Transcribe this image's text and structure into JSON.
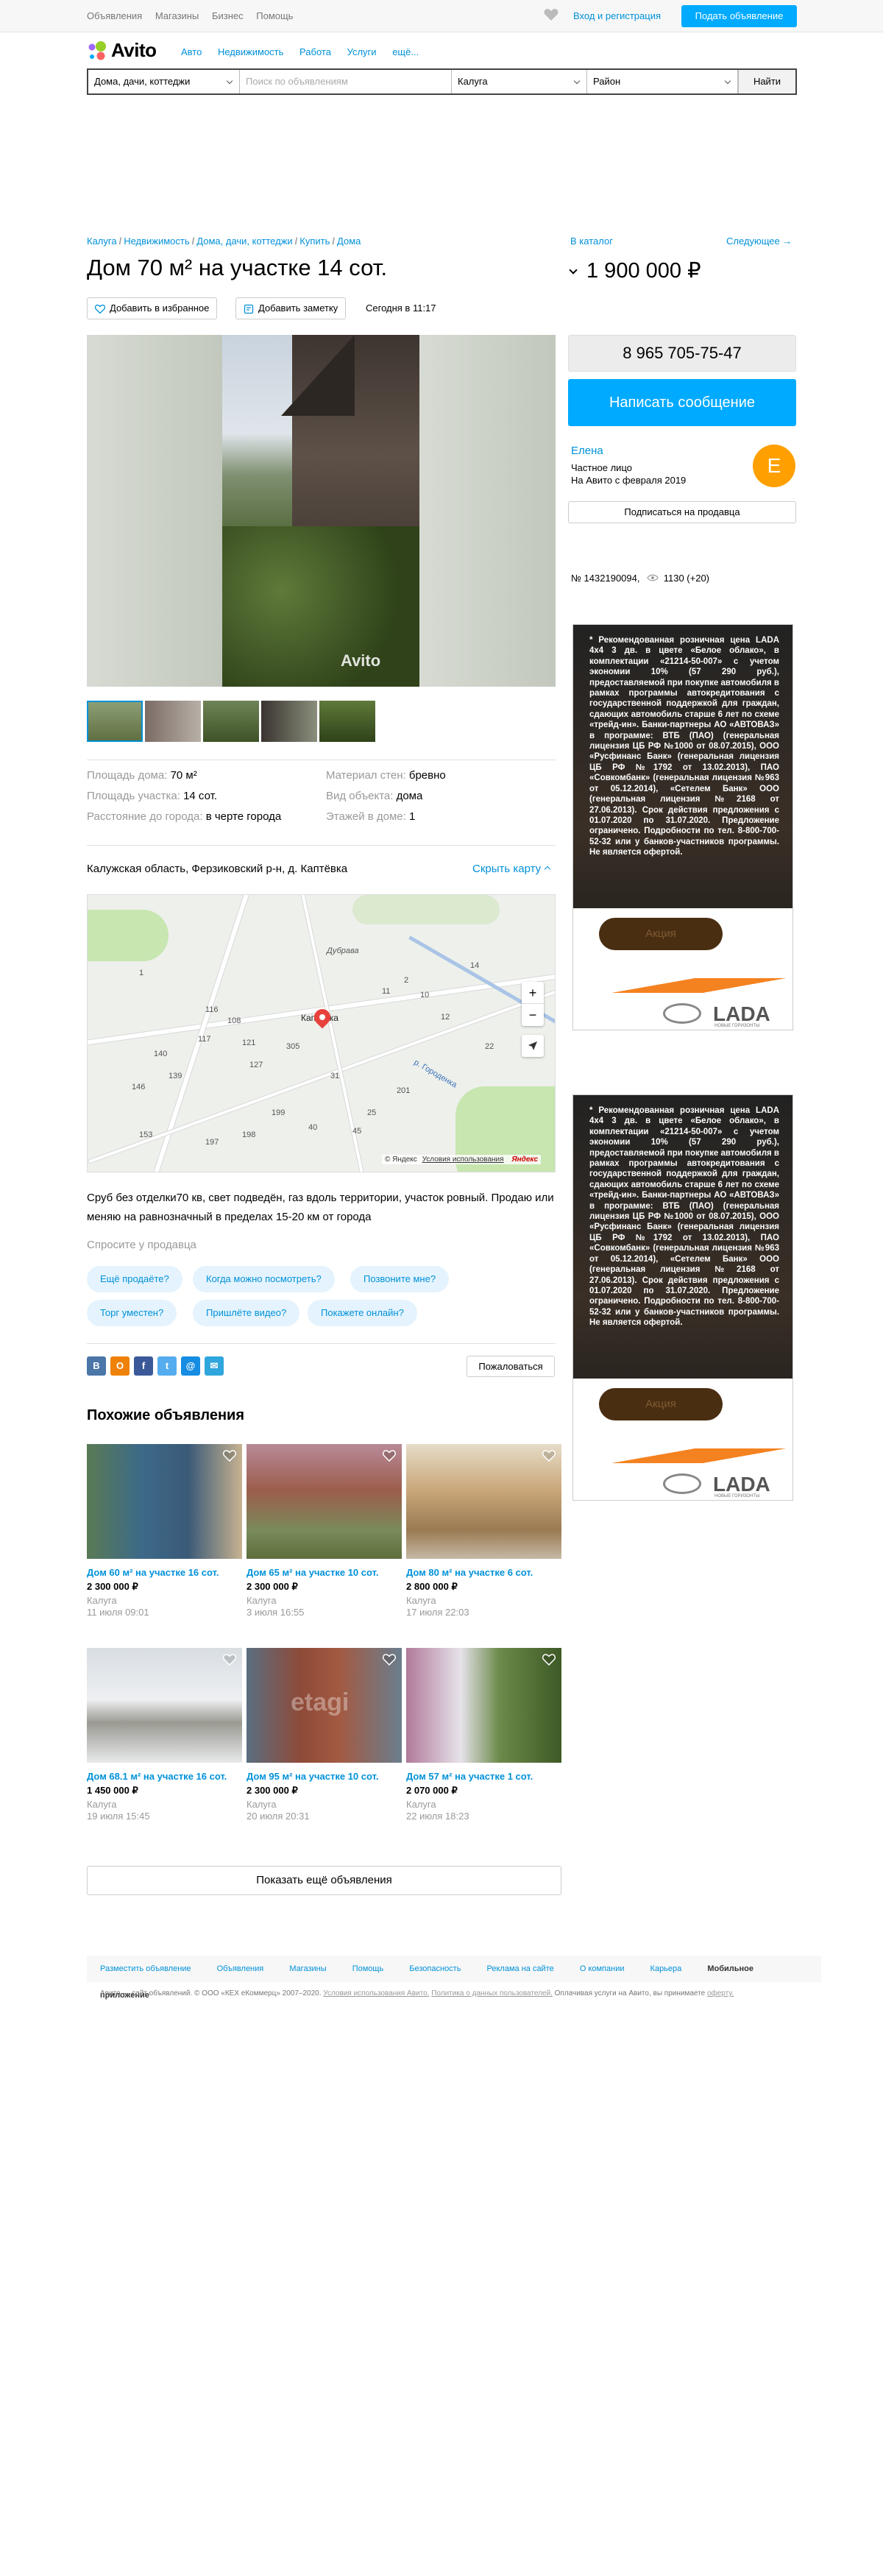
{
  "topbar": {
    "links": [
      "Объявления",
      "Магазины",
      "Бизнес",
      "Помощь"
    ],
    "login": "Вход и регистрация",
    "post_button": "Подать объявление"
  },
  "logo": {
    "text": "Avito"
  },
  "category_nav": [
    "Авто",
    "Недвижимость",
    "Работа",
    "Услуги",
    "ещё..."
  ],
  "search": {
    "category": "Дома, дачи, коттеджи",
    "placeholder": "Поиск по объявлениям",
    "city": "Калуга",
    "district": "Район",
    "button": "Найти"
  },
  "breadcrumbs": [
    "Калуга",
    "Недвижимость",
    "Дома, дачи, коттеджи",
    "Купить",
    "Дома"
  ],
  "catalog_link": "В каталог",
  "next_link": "Следующее →",
  "listing": {
    "title": "Дом 70 м² на участке 14 сот.",
    "price": "1 900 000 ₽",
    "favorite_button": "Добавить в избранное",
    "note_button": "Добавить заметку",
    "date": "Сегодня в 11:17",
    "watermark": "Avito"
  },
  "params": [
    {
      "key": "Площадь дома:",
      "value": "70 м²"
    },
    {
      "key": "Площадь участка:",
      "value": "14 сот."
    },
    {
      "key": "Расстояние до города:",
      "value": "в черте города"
    },
    {
      "key": "Материал стен:",
      "value": "бревно"
    },
    {
      "key": "Вид объекта:",
      "value": "дома"
    },
    {
      "key": "Этажей в доме:",
      "value": "1"
    }
  ],
  "address": "Калужская область, Ферзиковский р-н, д. Каптёвка",
  "hide_map": "Скрыть карту",
  "map": {
    "labels": {
      "village": "Каптёвка",
      "area": "Дубрава",
      "river": "р. Городенка",
      "houses": [
        "1",
        "2",
        "10",
        "11",
        "12",
        "14",
        "22",
        "25",
        "31",
        "40",
        "45",
        "108",
        "116",
        "117",
        "121",
        "127",
        "139",
        "140",
        "146",
        "153",
        "197",
        "198",
        "199",
        "201",
        "305"
      ]
    },
    "zoom_in": "+",
    "zoom_out": "−",
    "copyright": "© Яндекс",
    "terms": "Условия использования",
    "yandex": "Яндекс"
  },
  "description": "Сруб без отделки70 кв, свет подведён, газ вдоль территории, участок ровный. Продаю или меняю на равнозначный в пределах 15-20 км от города",
  "ask_seller": "Спросите у продавца",
  "chips": [
    "Ещё продаёте?",
    "Когда можно посмотреть?",
    "Позвоните мне?",
    "Торг уместен?",
    "Пришлёте видео?",
    "Покажете онлайн?"
  ],
  "share_icons": [
    "В",
    "О",
    "f",
    "t",
    "@",
    "✉"
  ],
  "complain": "Пожаловаться",
  "similar": {
    "heading": "Похожие объявления",
    "items": [
      {
        "title": "Дом 60 м² на участке 16 сот.",
        "price": "2 300 000 ₽",
        "city": "Калуга",
        "date": "11 июля 09:01"
      },
      {
        "title": "Дом 65 м² на участке 10 сот.",
        "price": "2 300 000 ₽",
        "city": "Калуга",
        "date": "3 июля 16:55"
      },
      {
        "title": "Дом 80 м² на участке 6 сот.",
        "price": "2 800 000 ₽",
        "city": "Калуга",
        "date": "17 июля 22:03"
      },
      {
        "title": "Дом 68.1 м² на участке 16 сот.",
        "price": "1 450 000 ₽",
        "city": "Калуга",
        "date": "19 июля 15:45"
      },
      {
        "title": "Дом 95 м² на участке 10 сот.",
        "price": "2 300 000 ₽",
        "city": "Калуга",
        "date": "20 июля 20:31"
      },
      {
        "title": "Дом 57 м² на участке 1 сот.",
        "price": "2 070 000 ₽",
        "city": "Калуга",
        "date": "22 июля 18:23"
      }
    ],
    "more_button": "Показать ещё объявления",
    "watermark": "etagi"
  },
  "sidebar": {
    "phone": "8 965 705-75-47",
    "message_button": "Написать сообщение",
    "seller_name": "Елена",
    "seller_type": "Частное лицо",
    "seller_since": "На Авито с февраля 2019",
    "avatar_letter": "E",
    "subscribe": "Подписаться на продавца",
    "ad_number": "№ 1432190094,",
    "views": "1130 (+20)"
  },
  "ad_banner": {
    "text": "* Рекомендованная розничная цена LADA 4x4 3 дв. в цвете «Белое облако», в комплектации «21214-50-007» с учетом экономии 10% (57 290 руб.), предоставляемой при покупке автомобиля в рамках программы автокредитования с государственной поддержкой для граждан, сдающих автомобиль старше 6 лет по схеме «трейд-ин». Банки-партнеры АО «АВТОВАЗ» в программе: ВТБ (ПАО) (генеральная лицензия ЦБ РФ №1000 от 08.07.2015), ООО «Русфинанс Банк» (генеральная лицензия ЦБ РФ №1792 от 13.02.2013), ПАО «Совкомбанк» (генеральная лицензия №963 от 05.12.2014), «Сетелем Банк» ООО (генеральная лицензия №2168 от 27.06.2013). Срок действия предложения с 01.07.2020 по 31.07.2020. Предложение ограничено. Подробности по тел. 8-800-700-52-32 или у банков-участников программы. Не является офертой.",
    "button": "Акция",
    "brand": "LADA",
    "brand_sub": "НОВЫЕ ГОРИЗОНТЫ"
  },
  "footer": {
    "links": [
      "Разместить объявление",
      "Объявления",
      "Магазины",
      "Помощь",
      "Безопасность",
      "Реклама на сайте",
      "О компании",
      "Карьера"
    ],
    "mobile": "Мобильное приложение",
    "legal_prefix": "Авито — сайт объявлений. © ООО «КЕХ еКоммерц» 2007–2020.",
    "legal_terms": "Условия использования Авито.",
    "legal_policy": "Политика о данных пользователей.",
    "legal_suffix": "Оплачивая услуги на Авито, вы принимаете",
    "legal_offer": "оферту."
  },
  "colors": {
    "accent": "#0091d9",
    "primary_button": "#00aaff",
    "avatar": "#ffa000"
  }
}
